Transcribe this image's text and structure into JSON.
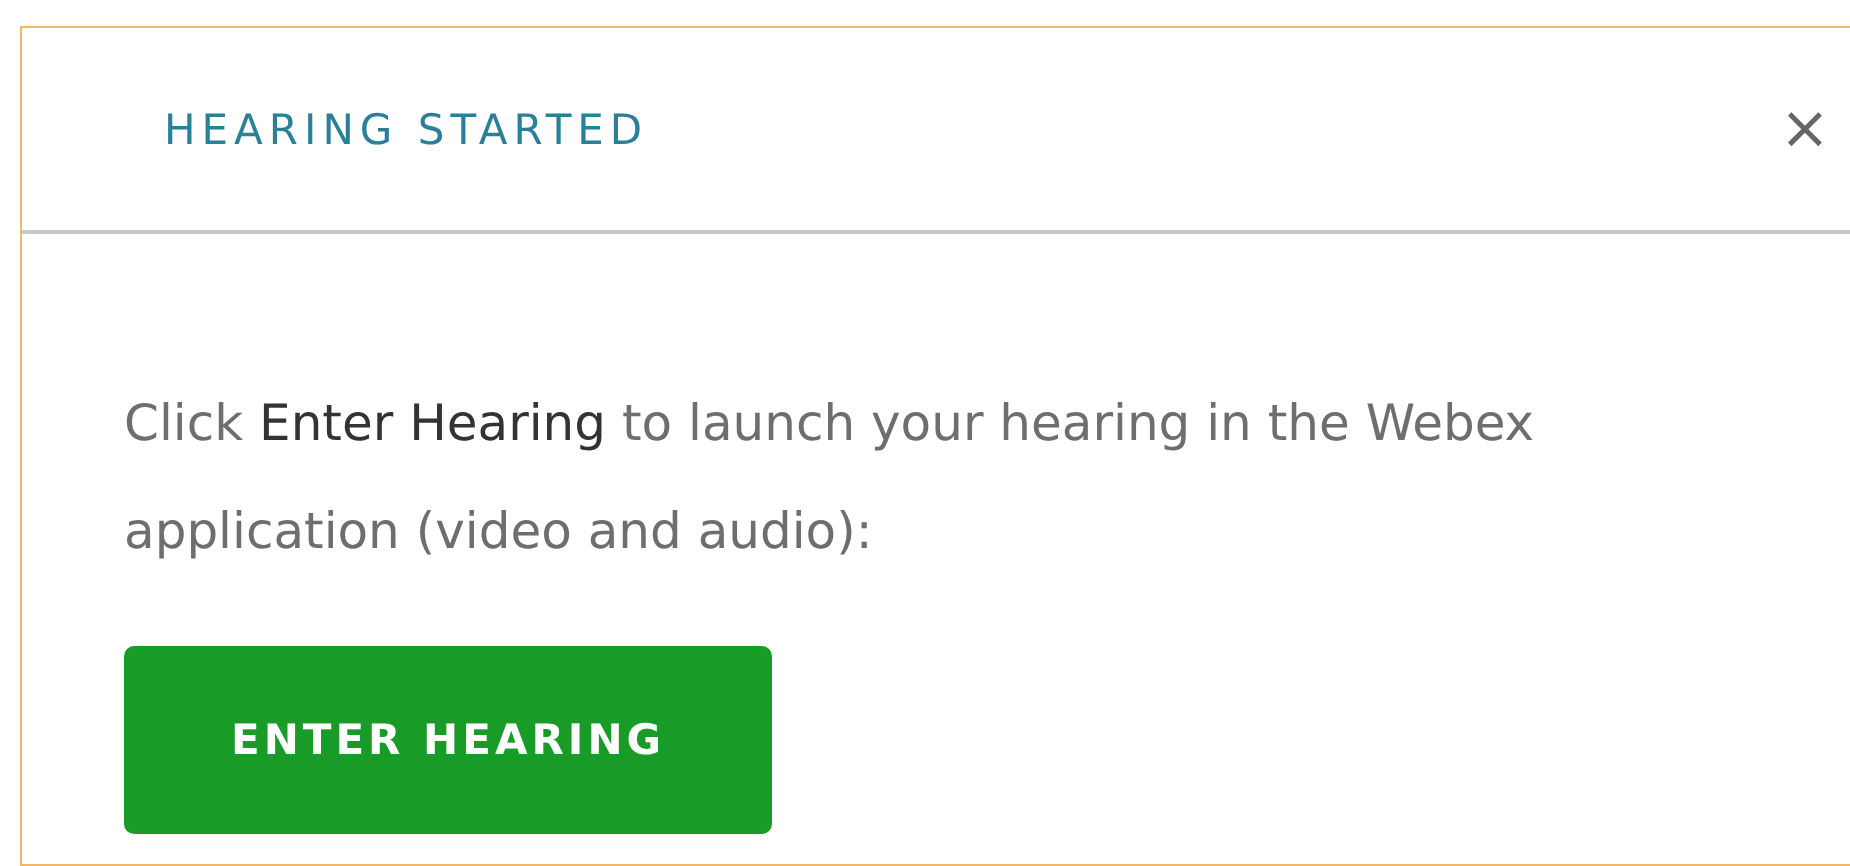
{
  "dialog": {
    "title": "HEARING STARTED",
    "close": "×",
    "message": "Click **Enter Hearing** to launch your hearing in the Webex application (video and audio):",
    "button": "ENTER HEARING"
  }
}
